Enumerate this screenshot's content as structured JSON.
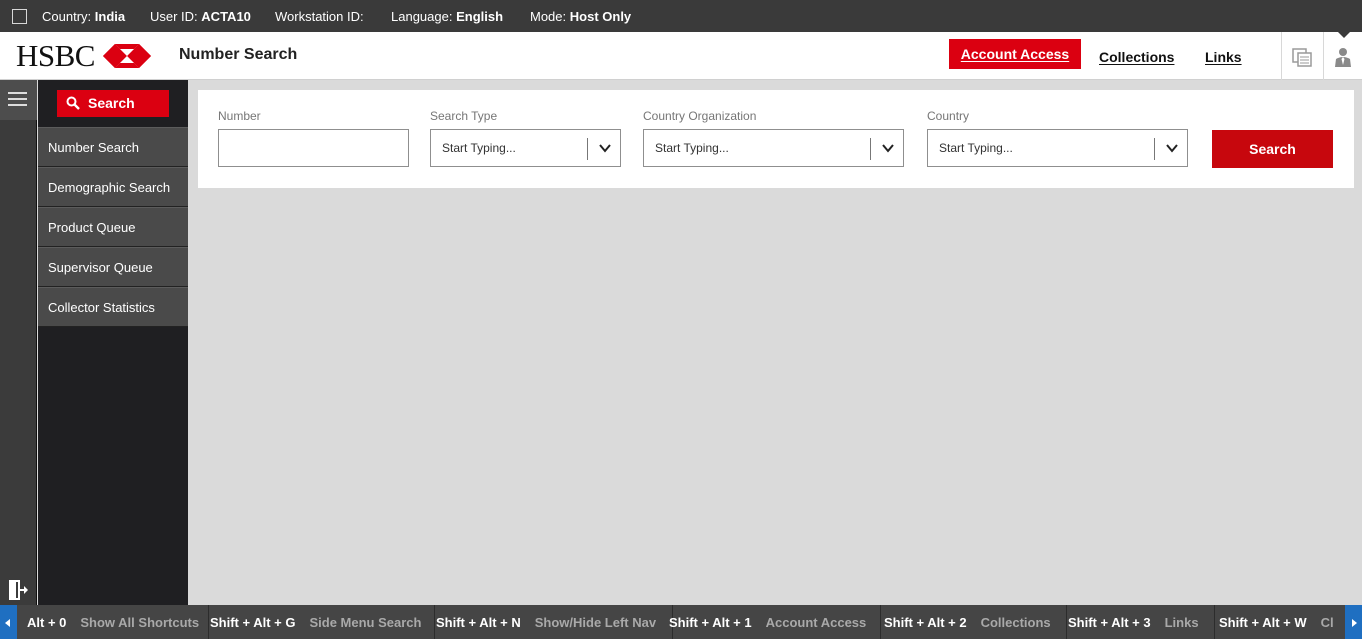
{
  "status_bar": {
    "country_label": "Country:",
    "country_value": "India",
    "user_label": "User ID:",
    "user_value": "ACTA10",
    "workstation_label": "Workstation ID:",
    "workstation_value": "",
    "language_label": "Language:",
    "language_value": "English",
    "mode_label": "Mode:",
    "mode_value": "Host Only"
  },
  "header": {
    "logo_text": "HSBC",
    "page_title": "Number Search",
    "account_access": "Account Access",
    "collections": "Collections",
    "links": "Links",
    "icons": [
      "copy-windows-icon",
      "user-profile-icon"
    ]
  },
  "sidebar": {
    "search_label": "Search",
    "items": [
      {
        "label": "Number Search"
      },
      {
        "label": "Demographic Search"
      },
      {
        "label": "Product Queue"
      },
      {
        "label": "Supervisor Queue"
      },
      {
        "label": "Collector Statistics"
      }
    ]
  },
  "search_form": {
    "number_label": "Number",
    "number_value": "",
    "search_type_label": "Search Type",
    "search_type_placeholder": "Start Typing...",
    "country_org_label": "Country Organization",
    "country_org_placeholder": "Start Typing...",
    "country_label": "Country",
    "country_placeholder": "Start Typing...",
    "search_button": "Search"
  },
  "shortcuts": [
    {
      "key": "Alt + 0",
      "desc": "Show All Shortcuts"
    },
    {
      "key": "Shift + Alt + G",
      "desc": "Side Menu Search"
    },
    {
      "key": "Shift + Alt + N",
      "desc": "Show/Hide Left Nav"
    },
    {
      "key": "Shift + Alt + 1",
      "desc": "Account Access"
    },
    {
      "key": "Shift + Alt + 2",
      "desc": "Collections"
    },
    {
      "key": "Shift + Alt + 3",
      "desc": "Links"
    },
    {
      "key": "Shift + Alt + W",
      "desc": "Cl"
    }
  ],
  "colors": {
    "brand_red": "#db0011",
    "status_bar": "#3a3a3a",
    "side_menu": "#1f1f22",
    "menu_item": "#4a4a4a",
    "scroll_arrow": "#1f6fc1"
  }
}
